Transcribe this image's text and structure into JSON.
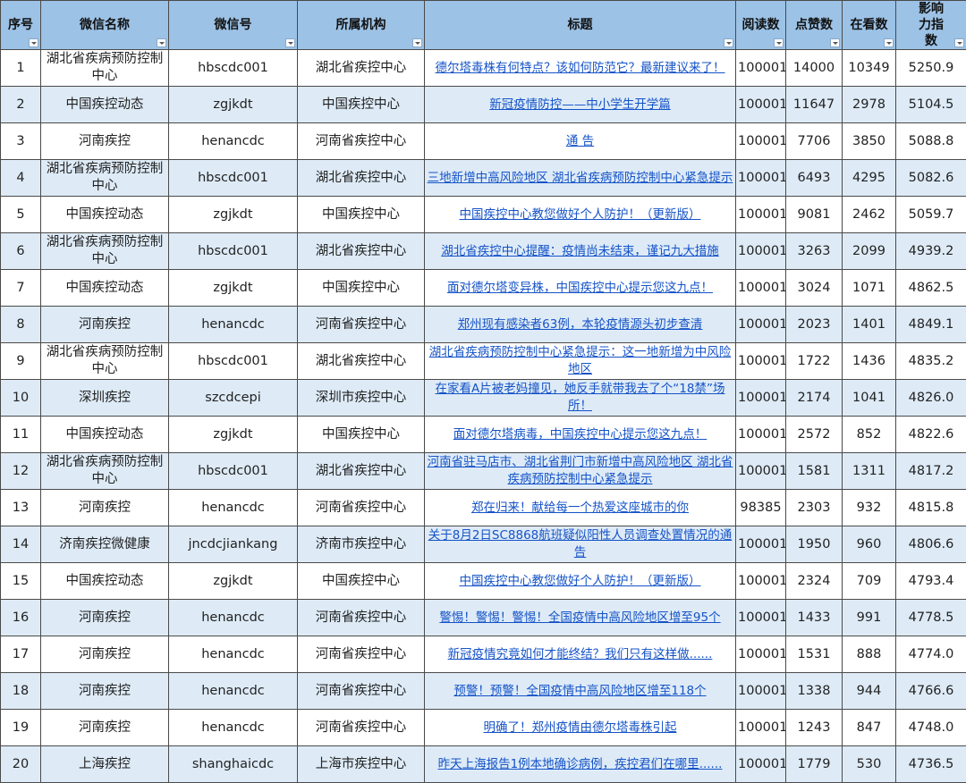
{
  "headers": [
    {
      "key": "seq",
      "label": "序号"
    },
    {
      "key": "name",
      "label": "微信名称"
    },
    {
      "key": "wxid",
      "label": "微信号"
    },
    {
      "key": "org",
      "label": "所属机构"
    },
    {
      "key": "title",
      "label": "标题"
    },
    {
      "key": "reads",
      "label": "阅读数"
    },
    {
      "key": "likes",
      "label": "点赞数"
    },
    {
      "key": "watching",
      "label": "在看数"
    },
    {
      "key": "influence",
      "label": "影响力指数"
    }
  ],
  "rows": [
    {
      "seq": "1",
      "name": "湖北省疾病预防控制中心",
      "wxid": "hbscdc001",
      "org": "湖北省疾控中心",
      "title": "德尔塔毒株有何特点？该如何防范它？最新建议来了！",
      "reads": "100001",
      "likes": "14000",
      "watching": "10349",
      "influence": "5250.9"
    },
    {
      "seq": "2",
      "name": "中国疾控动态",
      "wxid": "zgjkdt",
      "org": "中国疾控中心",
      "title": "新冠疫情防控——中小学生开学篇",
      "reads": "100001",
      "likes": "11647",
      "watching": "2978",
      "influence": "5104.5"
    },
    {
      "seq": "3",
      "name": "河南疾控",
      "wxid": "henancdc",
      "org": "河南省疾控中心",
      "title": "通 告",
      "reads": "100001",
      "likes": "7706",
      "watching": "3850",
      "influence": "5088.8"
    },
    {
      "seq": "4",
      "name": "湖北省疾病预防控制中心",
      "wxid": "hbscdc001",
      "org": "湖北省疾控中心",
      "title": "三地新增中高风险地区 湖北省疾病预防控制中心紧急提示",
      "reads": "100001",
      "likes": "6493",
      "watching": "4295",
      "influence": "5082.6"
    },
    {
      "seq": "5",
      "name": "中国疾控动态",
      "wxid": "zgjkdt",
      "org": "中国疾控中心",
      "title": "中国疾控中心教您做好个人防护！（更新版）",
      "reads": "100001",
      "likes": "9081",
      "watching": "2462",
      "influence": "5059.7"
    },
    {
      "seq": "6",
      "name": "湖北省疾病预防控制中心",
      "wxid": "hbscdc001",
      "org": "湖北省疾控中心",
      "title": "湖北省疾控中心提醒：疫情尚未结束，谨记九大措施",
      "reads": "100001",
      "likes": "3263",
      "watching": "2099",
      "influence": "4939.2"
    },
    {
      "seq": "7",
      "name": "中国疾控动态",
      "wxid": "zgjkdt",
      "org": "中国疾控中心",
      "title": "面对德尔塔变异株，中国疾控中心提示您这九点！",
      "reads": "100001",
      "likes": "3024",
      "watching": "1071",
      "influence": "4862.5"
    },
    {
      "seq": "8",
      "name": "河南疾控",
      "wxid": "henancdc",
      "org": "河南省疾控中心",
      "title": "郑州现有感染者63例，本轮疫情源头初步查清",
      "reads": "100001",
      "likes": "2023",
      "watching": "1401",
      "influence": "4849.1"
    },
    {
      "seq": "9",
      "name": "湖北省疾病预防控制中心",
      "wxid": "hbscdc001",
      "org": "湖北省疾控中心",
      "title": "湖北省疾病预防控制中心紧急提示：这一地新增为中风险地区",
      "reads": "100001",
      "likes": "1722",
      "watching": "1436",
      "influence": "4835.2"
    },
    {
      "seq": "10",
      "name": "深圳疾控",
      "wxid": "szcdcepi",
      "org": "深圳市疾控中心",
      "title": "在家看A片被老妈撞见，她反手就带我去了个“18禁”场所！",
      "reads": "100001",
      "likes": "2174",
      "watching": "1041",
      "influence": "4826.0"
    },
    {
      "seq": "11",
      "name": "中国疾控动态",
      "wxid": "zgjkdt",
      "org": "中国疾控中心",
      "title": "面对德尔塔病毒，中国疾控中心提示您这九点！",
      "reads": "100001",
      "likes": "2572",
      "watching": "852",
      "influence": "4822.6"
    },
    {
      "seq": "12",
      "name": "湖北省疾病预防控制中心",
      "wxid": "hbscdc001",
      "org": "湖北省疾控中心",
      "title": "河南省驻马店市、湖北省荆门市新增中高风险地区 湖北省疾病预防控制中心紧急提示",
      "reads": "100001",
      "likes": "1581",
      "watching": "1311",
      "influence": "4817.2"
    },
    {
      "seq": "13",
      "name": "河南疾控",
      "wxid": "henancdc",
      "org": "河南省疾控中心",
      "title": "郑在归来！献给每一个热爱这座城市的你",
      "reads": "98385",
      "likes": "2303",
      "watching": "932",
      "influence": "4815.8"
    },
    {
      "seq": "14",
      "name": "济南疾控微健康",
      "wxid": "jncdcjiankang",
      "org": "济南市疾控中心",
      "title": "关于8月2日SC8868航班疑似阳性人员调查处置情况的通告",
      "reads": "100001",
      "likes": "1950",
      "watching": "960",
      "influence": "4806.6"
    },
    {
      "seq": "15",
      "name": "中国疾控动态",
      "wxid": "zgjkdt",
      "org": "中国疾控中心",
      "title": "中国疾控中心教您做好个人防护！（更新版）",
      "reads": "100001",
      "likes": "2324",
      "watching": "709",
      "influence": "4793.4"
    },
    {
      "seq": "16",
      "name": "河南疾控",
      "wxid": "henancdc",
      "org": "河南省疾控中心",
      "title": "警惕！警惕！警惕！全国疫情中高风险地区增至95个",
      "reads": "100001",
      "likes": "1433",
      "watching": "991",
      "influence": "4778.5"
    },
    {
      "seq": "17",
      "name": "河南疾控",
      "wxid": "henancdc",
      "org": "河南省疾控中心",
      "title": "新冠疫情究竟如何才能终结？我们只有这样做......",
      "reads": "100001",
      "likes": "1531",
      "watching": "888",
      "influence": "4774.0"
    },
    {
      "seq": "18",
      "name": "河南疾控",
      "wxid": "henancdc",
      "org": "河南省疾控中心",
      "title": "预警！预警！全国疫情中高风险地区增至118个",
      "reads": "100001",
      "likes": "1338",
      "watching": "944",
      "influence": "4766.6"
    },
    {
      "seq": "19",
      "name": "河南疾控",
      "wxid": "henancdc",
      "org": "河南省疾控中心",
      "title": "明确了！郑州疫情由德尔塔毒株引起",
      "reads": "100001",
      "likes": "1243",
      "watching": "847",
      "influence": "4748.0"
    },
    {
      "seq": "20",
      "name": "上海疾控",
      "wxid": "shanghaicdc",
      "org": "上海市疾控中心",
      "title": "昨天上海报告1例本地确诊病例，疾控君们在哪里......",
      "reads": "100001",
      "likes": "1779",
      "watching": "530",
      "influence": "4736.5"
    }
  ],
  "colors": {
    "header_bg": "#9cc2e6",
    "row_stripe": "#deebf7",
    "row_plain": "#ffffff",
    "link": "#1553c7",
    "border": "#4a4a4a"
  }
}
